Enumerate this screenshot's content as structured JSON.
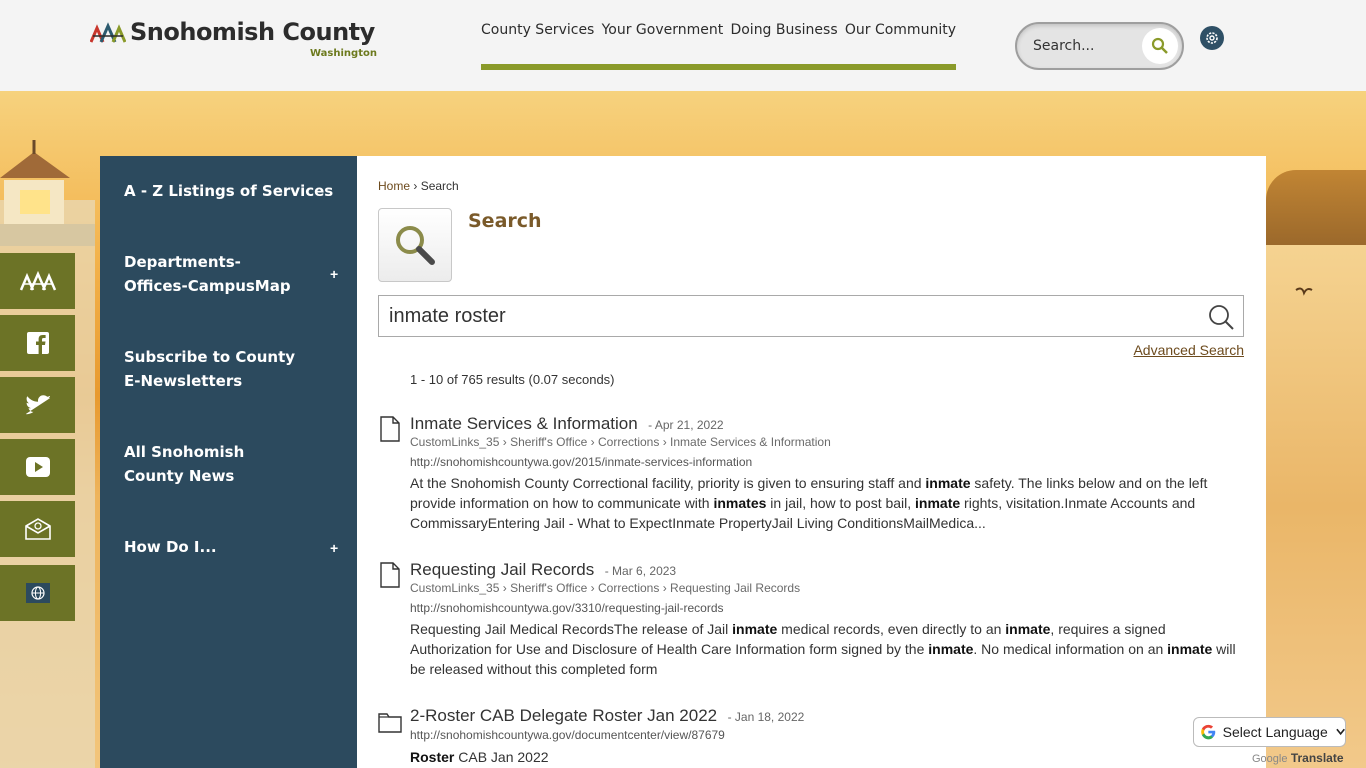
{
  "header": {
    "logo_text": "Snohomish County",
    "logo_sub": "Washington",
    "nav": [
      "County Services",
      "Your Government",
      "Doing Business",
      "Our Community"
    ],
    "search_placeholder": "Search..."
  },
  "leftnav": {
    "items": [
      {
        "label": "A - Z Listings of Services",
        "expandable": false
      },
      {
        "label": "Departments-Offices-CampusMap",
        "expandable": true
      },
      {
        "label": "Subscribe to County E-Newsletters",
        "expandable": false
      },
      {
        "label": "All Snohomish County News",
        "expandable": false
      },
      {
        "label": "How Do I...",
        "expandable": true
      }
    ],
    "plus": "+"
  },
  "social": [
    "county-logo-icon",
    "facebook-icon",
    "twitter-icon",
    "youtube-icon",
    "email-icon",
    "globe-icon"
  ],
  "content": {
    "breadcrumb_home": "Home",
    "breadcrumb_sep": "›",
    "breadcrumb_current": "Search",
    "title": "Search",
    "query": "inmate roster",
    "advanced": "Advanced Search",
    "count": "1 - 10 of 765 results (0.07 seconds)",
    "results": [
      {
        "title": "Inmate Services & Information",
        "date": "- Apr 21, 2022",
        "path": [
          "CustomLinks_35",
          "Sheriff's Office",
          "Corrections",
          "Inmate Services & Information"
        ],
        "url": "http://snohomishcountywa.gov/2015/inmate-services-information",
        "snippet": "At the Snohomish County Correctional facility, priority is given to ensuring staff and **inmate** safety. The links below and on the left provide information on how to communicate with **inmates** in jail, how to post bail, **inmate** rights, visitation.Inmate Accounts and CommissaryEntering Jail - What to ExpectInmate PropertyJail Living ConditionsMailMedica..."
      },
      {
        "title": "Requesting Jail Records",
        "date": "- Mar 6, 2023",
        "path": [
          "CustomLinks_35",
          "Sheriff's Office",
          "Corrections",
          "Requesting Jail Records"
        ],
        "url": "http://snohomishcountywa.gov/3310/requesting-jail-records",
        "snippet": "Requesting Jail Medical RecordsThe release of Jail **inmate** medical records, even directly to an **inmate**, requires a signed Authorization for Use and Disclosure of Health Care Information form signed by the **inmate**. No medical information on an **inmate** will be released without this completed form"
      },
      {
        "title": "2-Roster CAB Delegate Roster Jan 2022",
        "date": "- Jan 18, 2022",
        "path": [],
        "url": "http://snohomishcountywa.gov/documentcenter/view/87679",
        "snippet": "**Roster** CAB Jan 2022"
      }
    ]
  },
  "translate": {
    "label": "Select Language",
    "credit_google": "Google",
    "credit_translate": "Translate"
  },
  "colors": {
    "nav_bar": "#8a9a2a",
    "leftnav_bg": "#2c4a5e",
    "social_bg": "#6c7326",
    "title_brown": "#7a5a2a"
  }
}
